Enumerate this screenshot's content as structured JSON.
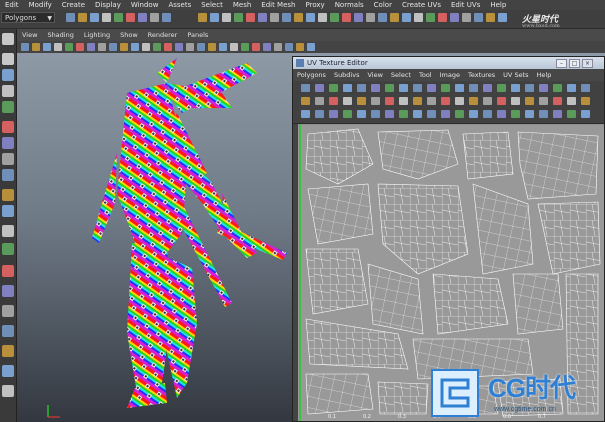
{
  "menubar": {
    "items": [
      "Edit",
      "Modify",
      "Create",
      "Display",
      "Window",
      "Assets",
      "Select",
      "Mesh",
      "Edit Mesh",
      "Proxy",
      "Normals",
      "Color",
      "Create UVs",
      "Edit UVs",
      "Help"
    ]
  },
  "shelf": {
    "mode": "Polygons"
  },
  "branding": {
    "top_logo": "火星时代",
    "top_logo_url": "www.hxsd.com",
    "cg_text": "CG时代",
    "cg_url": "www.cgtime.com.cn"
  },
  "panel": {
    "menu": [
      "View",
      "Shading",
      "Lighting",
      "Show",
      "Renderer",
      "Panels"
    ]
  },
  "uv_editor": {
    "title": "UV Texture Editor",
    "menu": [
      "Polygons",
      "Subdivs",
      "View",
      "Select",
      "Tool",
      "Image",
      "Textures",
      "UV Sets",
      "Help"
    ],
    "ruler": [
      "0.1",
      "0.2",
      "0.3",
      "0.4",
      "0.5",
      "0.6",
      "0.7"
    ]
  },
  "viewport": {
    "axis_labels": [
      "y",
      "x"
    ]
  },
  "colors": {
    "menubar_bg": "#434343",
    "viewport_top": "#8e99a6",
    "viewport_bottom": "#333840",
    "uv_grid_bg": "#999999",
    "uv_wire": "#ffffff",
    "cg_blue": "#2f7fd3"
  }
}
